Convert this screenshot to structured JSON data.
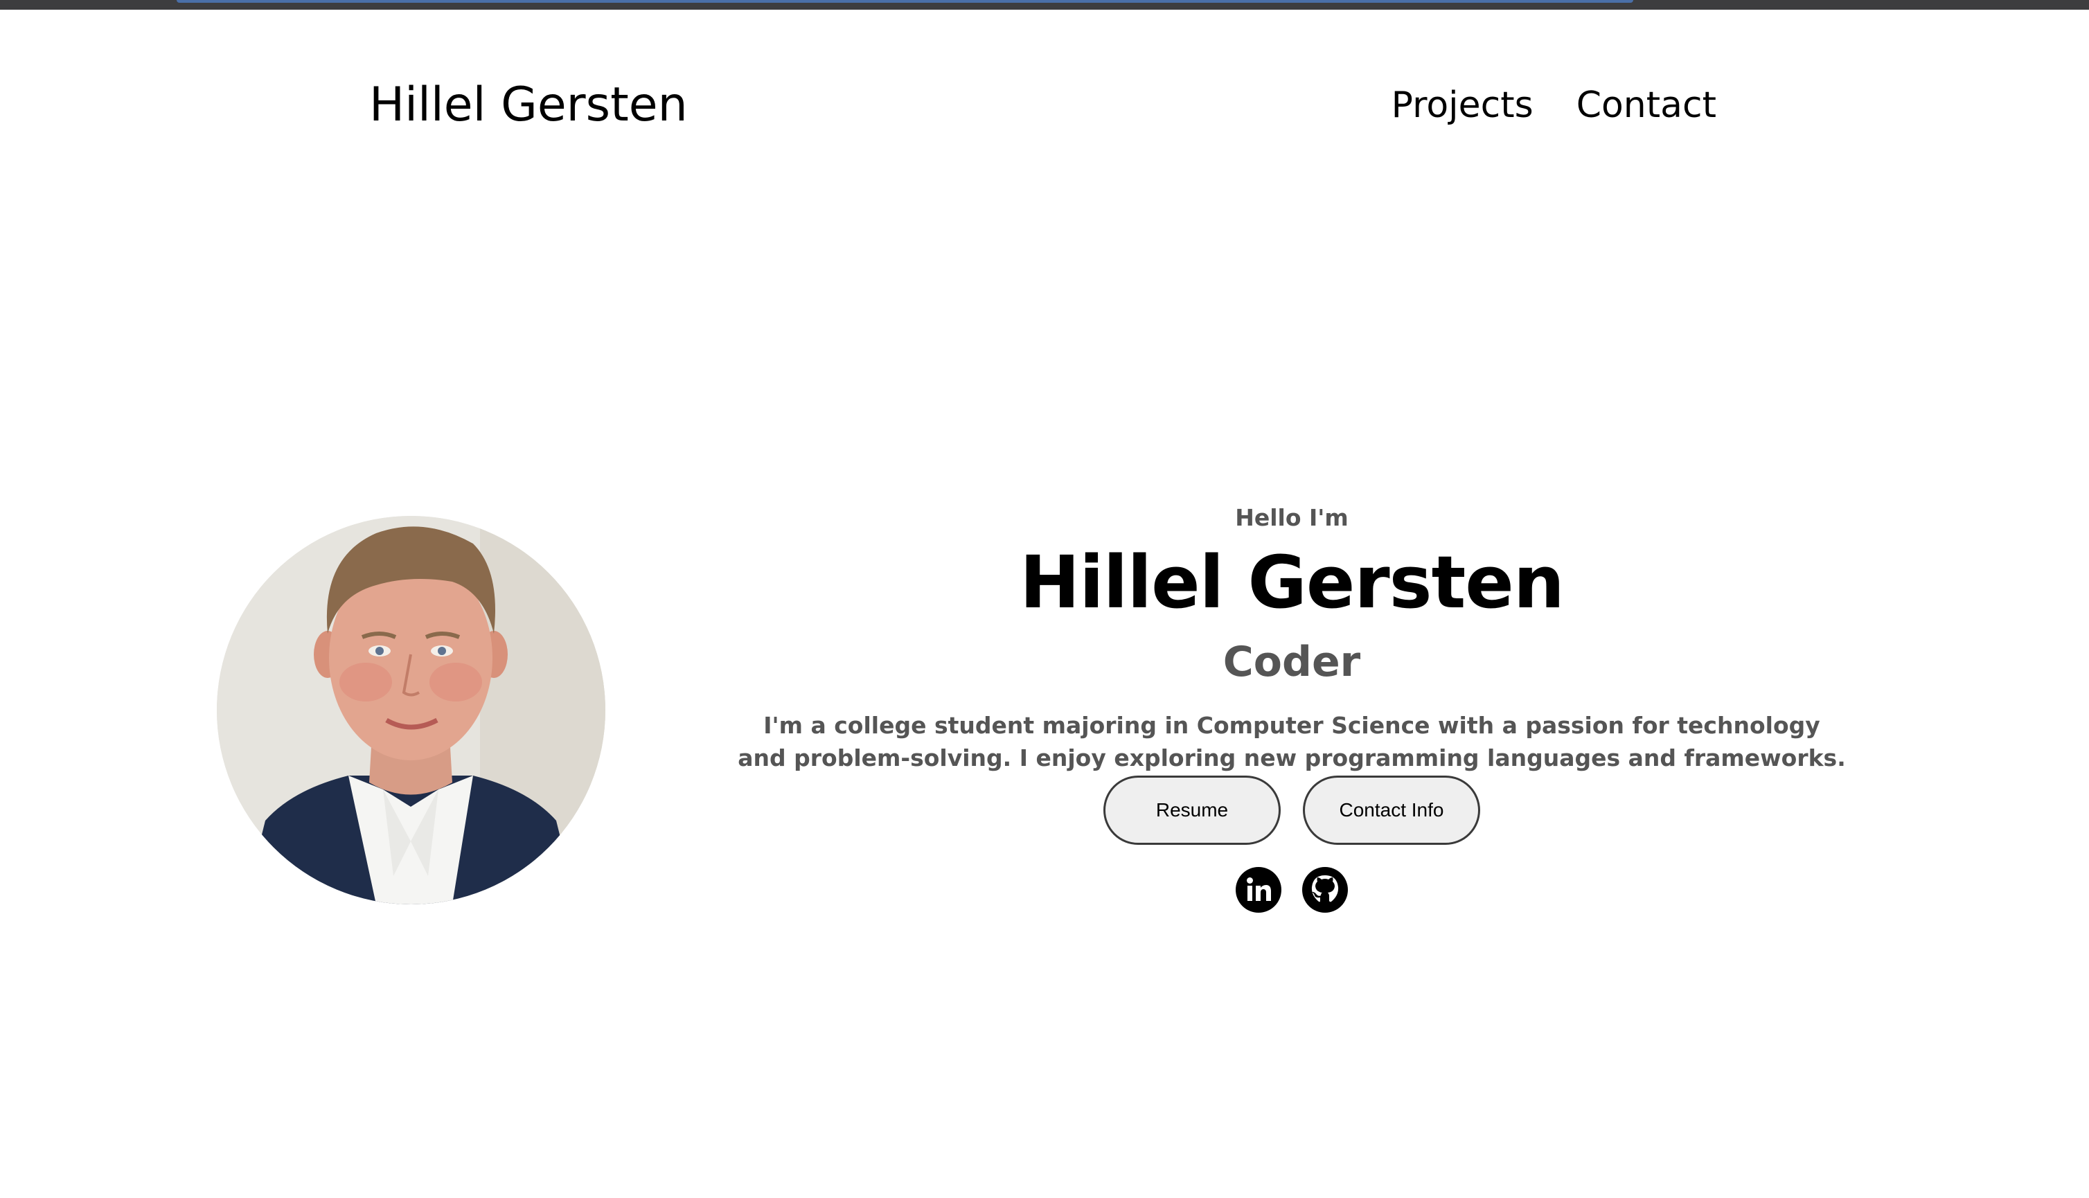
{
  "nav": {
    "logo": "Hillel Gersten",
    "links": [
      "Projects",
      "Contact"
    ]
  },
  "profile": {
    "image_alt": "Profile picture"
  },
  "hero": {
    "greeting": "Hello I'm",
    "name": "Hillel Gersten",
    "role": "Coder",
    "bio": "I'm a college student majoring in Computer Science with a passion for technology and problem-solving. I enjoy exploring new programming languages and frameworks.",
    "buttons": {
      "resume": "Resume",
      "contact_info": "Contact Info"
    },
    "socials": {
      "linkedin_icon": "linkedin-icon",
      "github_icon": "github-icon"
    }
  },
  "colors": {
    "text_primary": "#000000",
    "text_secondary": "#555555",
    "button_bg": "#efefef",
    "button_border": "#3a3a3a",
    "top_strip": "#3d3d3f"
  }
}
